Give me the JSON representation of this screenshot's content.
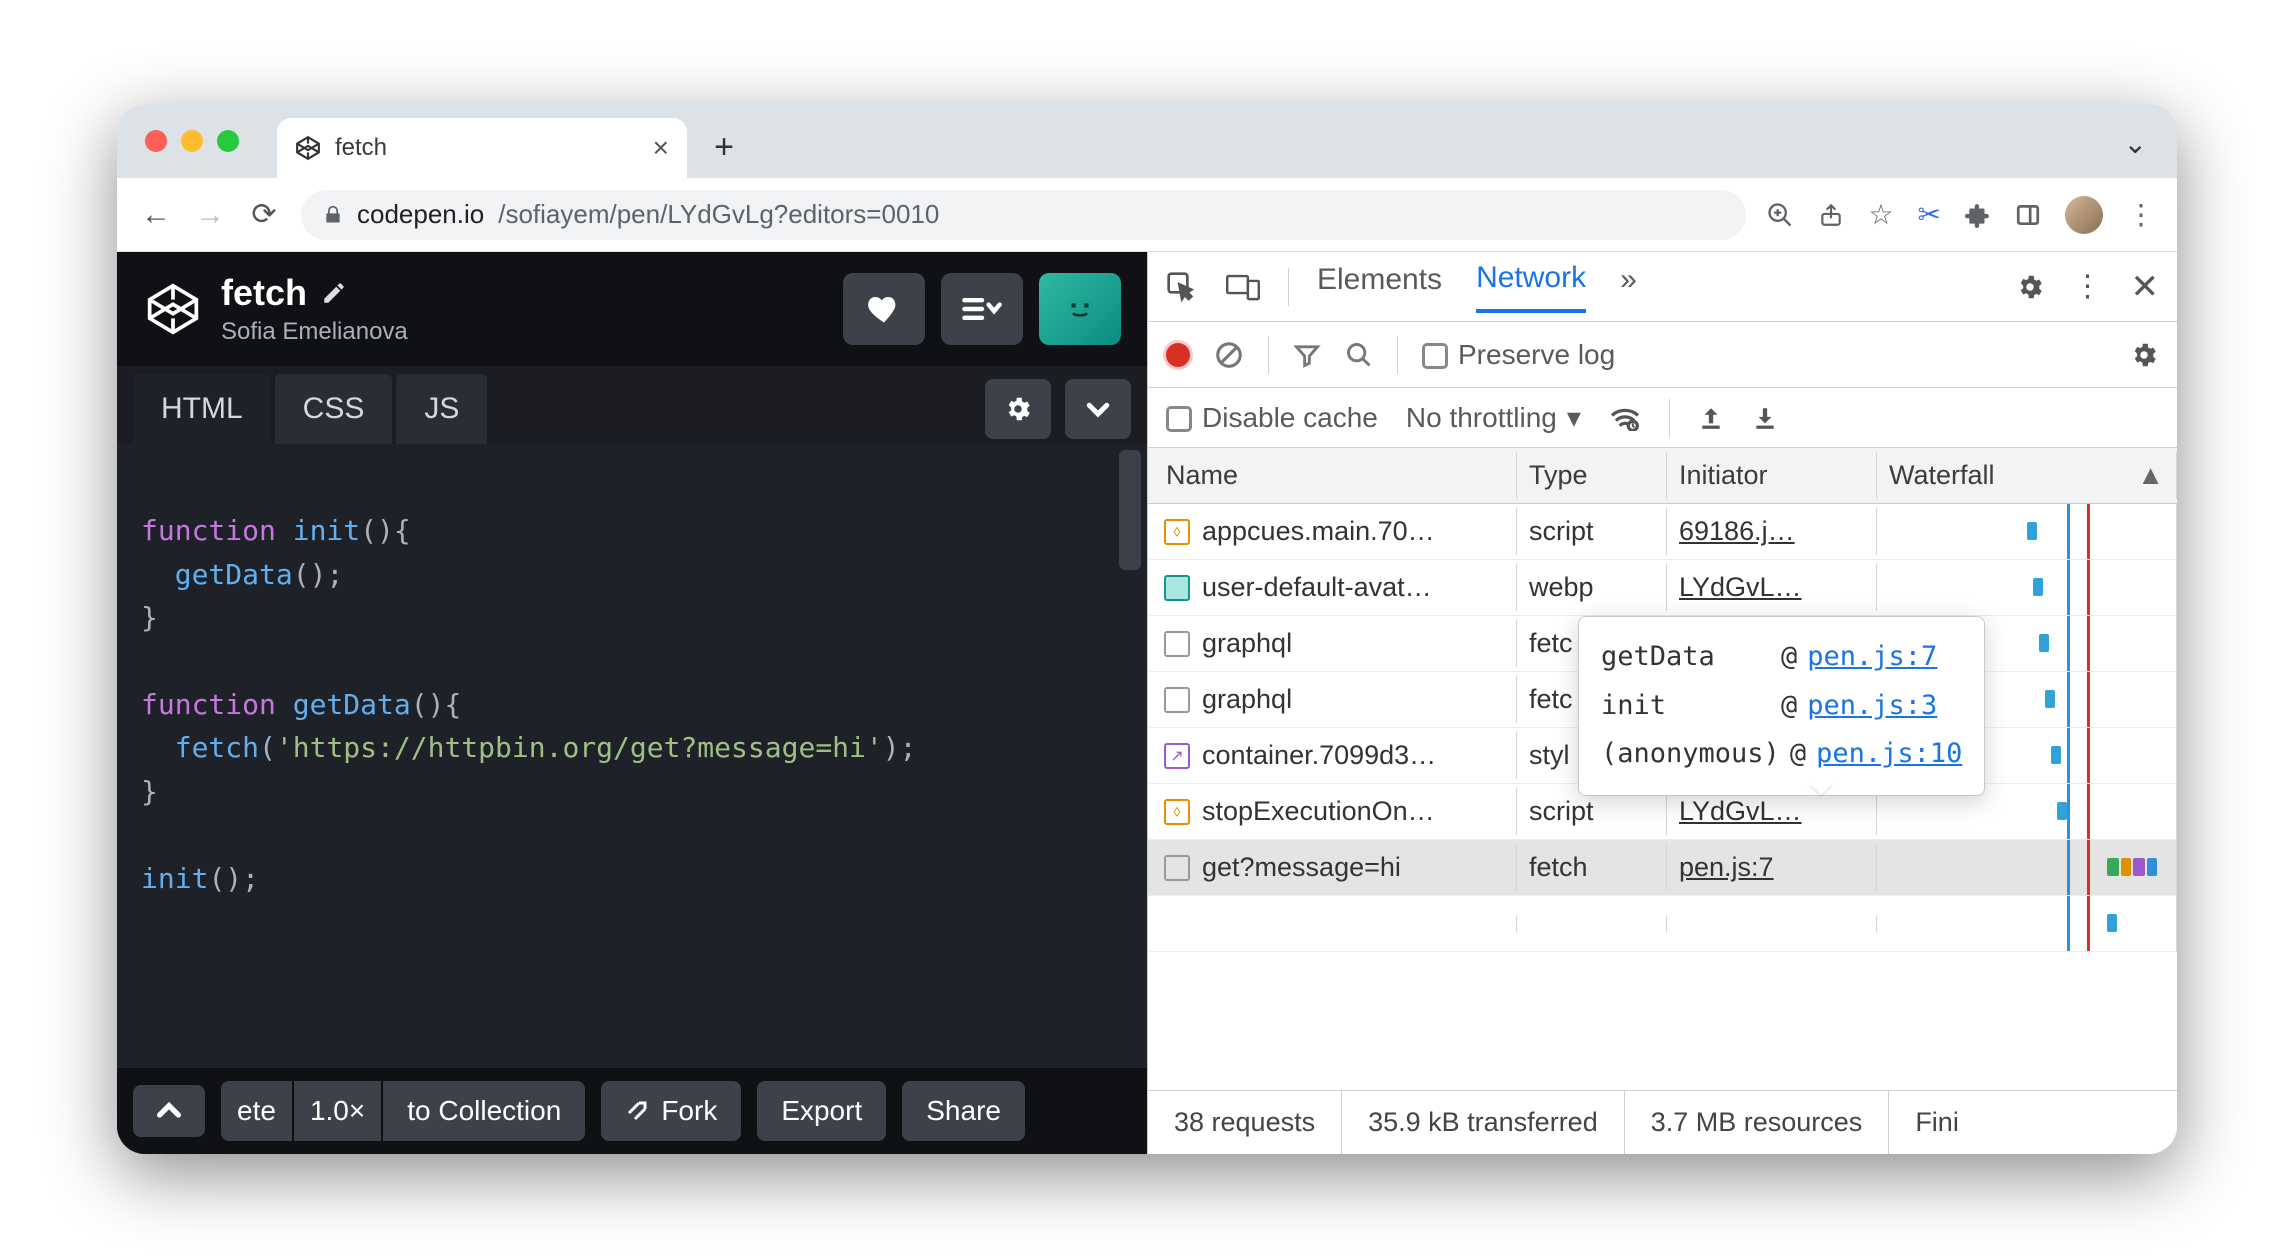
{
  "browser": {
    "tab_title": "fetch",
    "address_host": "codepen.io",
    "address_path": "/sofiayem/pen/LYdGvLg?editors=0010"
  },
  "codepen": {
    "title": "fetch",
    "author": "Sofia Emelianova",
    "tabs": {
      "html": "HTML",
      "css": "CSS",
      "js": "JS"
    },
    "code": {
      "l1a": "function",
      "l1b": "init",
      "l1c": "(){",
      "l2a": "getData",
      "l2b": "();",
      "l3": "}",
      "l5a": "function",
      "l5b": "getData",
      "l5c": "(){",
      "l6a": "fetch",
      "l6b": "(",
      "l6c": "'https://httpbin.org/get?message=hi'",
      "l6d": ");",
      "l7": "}",
      "l9a": "init",
      "l9b": "();"
    },
    "footer": {
      "zoom_frag": "ete",
      "zoom": "1.0×",
      "collection": "to Collection",
      "fork": "Fork",
      "export": "Export",
      "share": "Share"
    }
  },
  "devtools": {
    "tabs": {
      "elements": "Elements",
      "network": "Network",
      "more": "»"
    },
    "toolbar": {
      "preserve_log": "Preserve log"
    },
    "toolbar2": {
      "disable_cache": "Disable cache",
      "throttling": "No throttling"
    },
    "columns": {
      "name": "Name",
      "type": "Type",
      "initiator": "Initiator",
      "waterfall": "Waterfall"
    },
    "rows": [
      {
        "name": "appcues.main.70…",
        "type": "script",
        "initiator": "69186.j…",
        "icon": "orange"
      },
      {
        "name": "user-default-avat…",
        "type": "webp",
        "initiator": "LYdGvL…",
        "icon": "teal"
      },
      {
        "name": "graphql",
        "type": "fetc",
        "initiator": "",
        "icon": "empty"
      },
      {
        "name": "graphql",
        "type": "fetc",
        "initiator": "",
        "icon": "empty"
      },
      {
        "name": "container.7099d3…",
        "type": "styl",
        "initiator": "",
        "icon": "purple"
      },
      {
        "name": "stopExecutionOn…",
        "type": "script",
        "initiator": "LYdGvL…",
        "icon": "orange"
      },
      {
        "name": "get?message=hi",
        "type": "fetch",
        "initiator": "pen.js:7",
        "icon": "empty",
        "selected": true
      }
    ],
    "tooltip": {
      "r1_name": "getData",
      "r1_at": "@",
      "r1_link": "pen.js:7",
      "r2_name": "init",
      "r2_at": "@",
      "r2_link": "pen.js:3",
      "r3_name": "(anonymous)",
      "r3_at": "@",
      "r3_link": "pen.js:10"
    },
    "footer": {
      "requests": "38 requests",
      "transferred": "35.9 kB transferred",
      "resources": "3.7 MB resources",
      "finish": "Fini"
    }
  }
}
